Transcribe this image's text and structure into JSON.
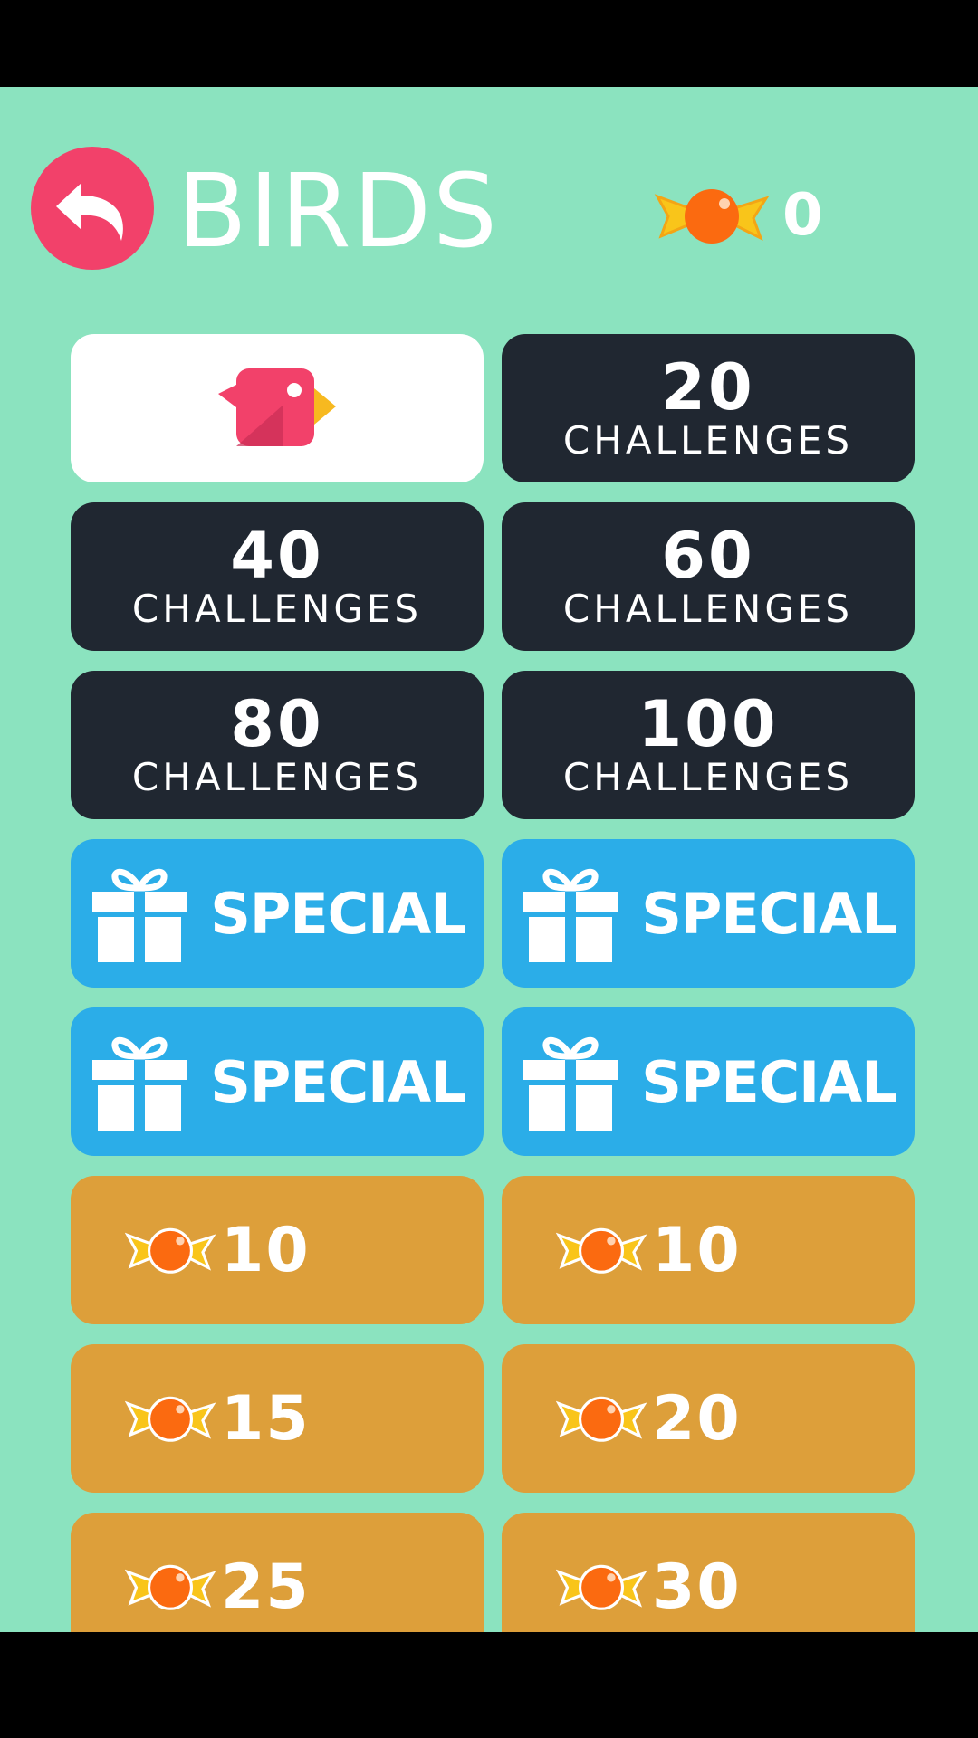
{
  "header": {
    "title": "BIRDS",
    "candy_count": "0",
    "back_icon": "back-arrow-icon"
  },
  "tiles": {
    "selected_bird": {
      "icon": "pink-bird-icon"
    },
    "challenges": [
      {
        "number": "20",
        "label": "CHALLENGES"
      },
      {
        "number": "40",
        "label": "CHALLENGES"
      },
      {
        "number": "60",
        "label": "CHALLENGES"
      },
      {
        "number": "80",
        "label": "CHALLENGES"
      },
      {
        "number": "100",
        "label": "CHALLENGES"
      }
    ],
    "specials": [
      {
        "label": "SPECIAL",
        "icon": "gift-icon"
      },
      {
        "label": "SPECIAL",
        "icon": "gift-icon"
      },
      {
        "label": "SPECIAL",
        "icon": "gift-icon"
      },
      {
        "label": "SPECIAL",
        "icon": "gift-icon"
      }
    ],
    "prices": [
      {
        "amount": "10",
        "icon": "candy-icon"
      },
      {
        "amount": "10",
        "icon": "candy-icon"
      },
      {
        "amount": "15",
        "icon": "candy-icon"
      },
      {
        "amount": "20",
        "icon": "candy-icon"
      },
      {
        "amount": "25",
        "icon": "candy-icon"
      },
      {
        "amount": "30",
        "icon": "candy-icon"
      }
    ]
  },
  "colors": {
    "background": "#8be3bf",
    "back_button": "#f2416a",
    "challenge_tile": "#202731",
    "special_tile": "#2bade8",
    "price_tile": "#dd9f3a"
  }
}
